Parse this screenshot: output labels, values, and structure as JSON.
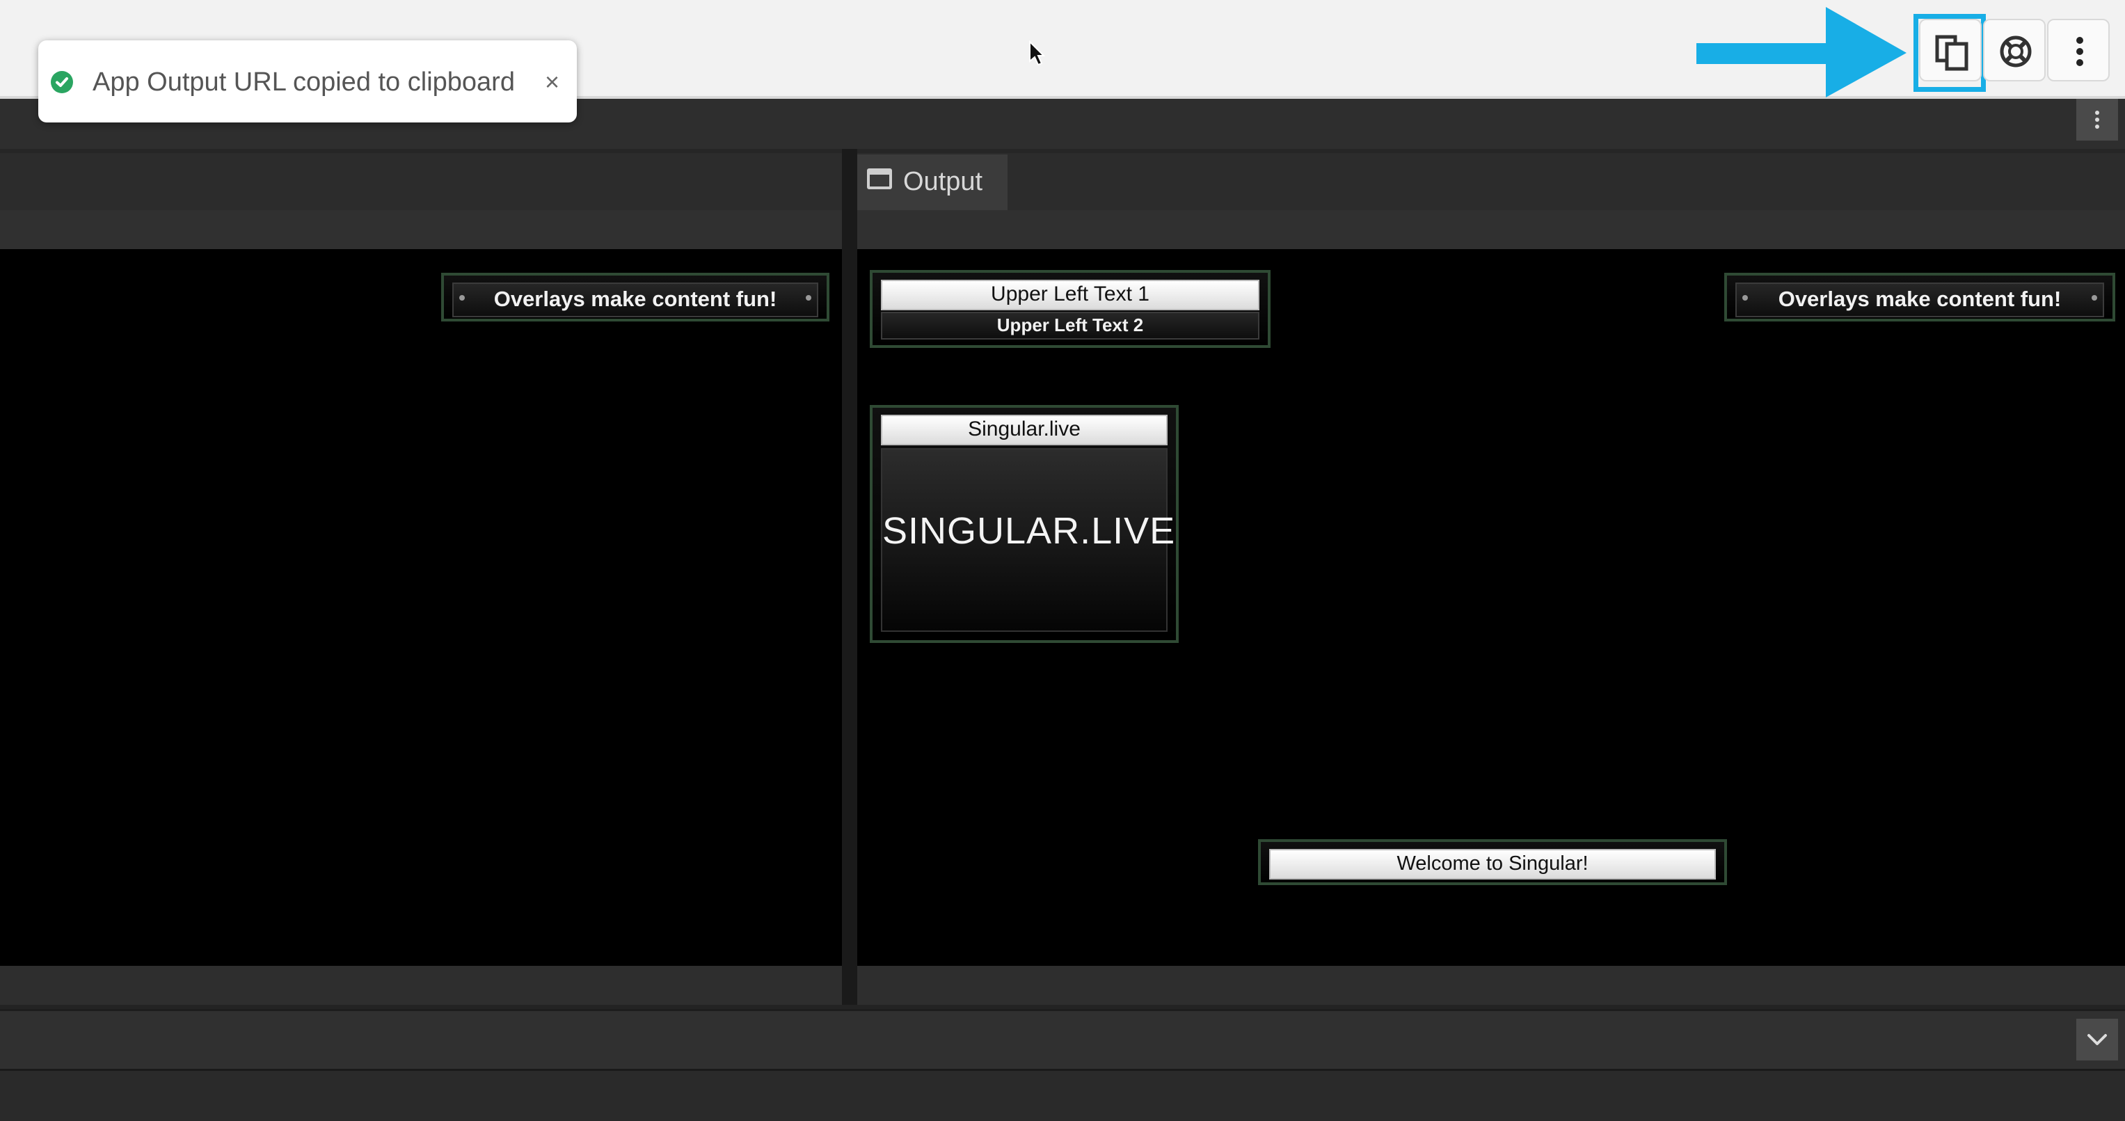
{
  "toast": {
    "message": "App Output URL copied to clipboard",
    "close": "×",
    "status_color": "#2aa561"
  },
  "toolbar": {
    "buttons": [
      {
        "name": "copy-output-url",
        "icon": "copy-icon"
      },
      {
        "name": "help",
        "icon": "lifebuoy-icon"
      },
      {
        "name": "more-options",
        "icon": "kebab-icon"
      }
    ],
    "highlight_color": "#18aee6"
  },
  "panels": {
    "output_tab": {
      "label": "Output",
      "icon": "window-icon"
    }
  },
  "left_preview": {
    "overlay_top_right": "Overlays make content fun!"
  },
  "output_preview": {
    "upper_left_1": "Upper Left Text 1",
    "upper_left_2": "Upper Left Text 2",
    "logo_title": "Singular.live",
    "logo_text": "SINGULAR.LIVE",
    "overlay_top_right": "Overlays make content fun!",
    "lower_third": "Welcome to Singular!"
  }
}
